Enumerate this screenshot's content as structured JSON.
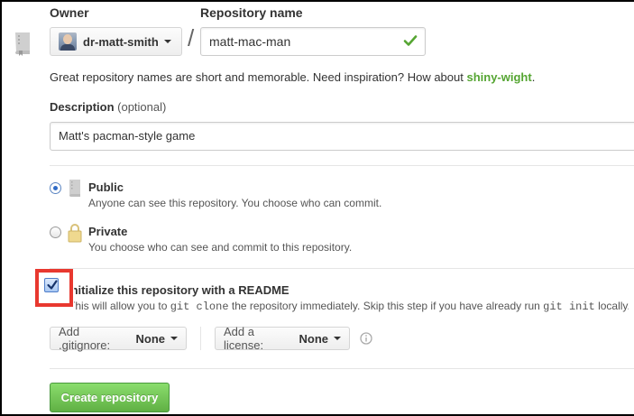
{
  "form": {
    "owner_label": "Owner",
    "repo_name_label": "Repository name",
    "owner_value": "dr-matt-smith",
    "slash": "/",
    "repo_name_value": "matt-mac-man",
    "name_hint_prefix": "Great repository names are short and memorable. Need inspiration? How about ",
    "name_suggestion": "shiny-wight",
    "name_hint_suffix": ".",
    "description_label": "Description",
    "description_optional": "(optional)",
    "description_value": "Matt's pacman-style game"
  },
  "visibility": {
    "selected": "Public",
    "options": [
      {
        "title": "Public",
        "desc": "Anyone can see this repository. You choose who can commit."
      },
      {
        "title": "Private",
        "desc": "You choose who can see and commit to this repository."
      }
    ]
  },
  "readme": {
    "checked": true,
    "label": "Initialize this repository with a README",
    "desc_part1": "This will allow you to ",
    "desc_code1": "git clone",
    "desc_part2": " the repository immediately. Skip this step if you have already run ",
    "desc_code2": "git init",
    "desc_part3": " locally."
  },
  "selects": {
    "gitignore_label": "Add .gitignore:",
    "gitignore_value": "None",
    "license_label": "Add a license:",
    "license_value": "None"
  },
  "actions": {
    "create_label": "Create repository"
  },
  "colors": {
    "accent_green": "#55a532",
    "button_green": "#60b044",
    "highlight_red": "#e8382f",
    "radio_blue": "#2f6bc7"
  },
  "icons": {
    "repo": "repo-book-icon",
    "valid": "check-icon",
    "public": "repo-book-icon",
    "private": "lock-icon",
    "info": "info-icon",
    "dropdown": "caret-down-icon"
  }
}
